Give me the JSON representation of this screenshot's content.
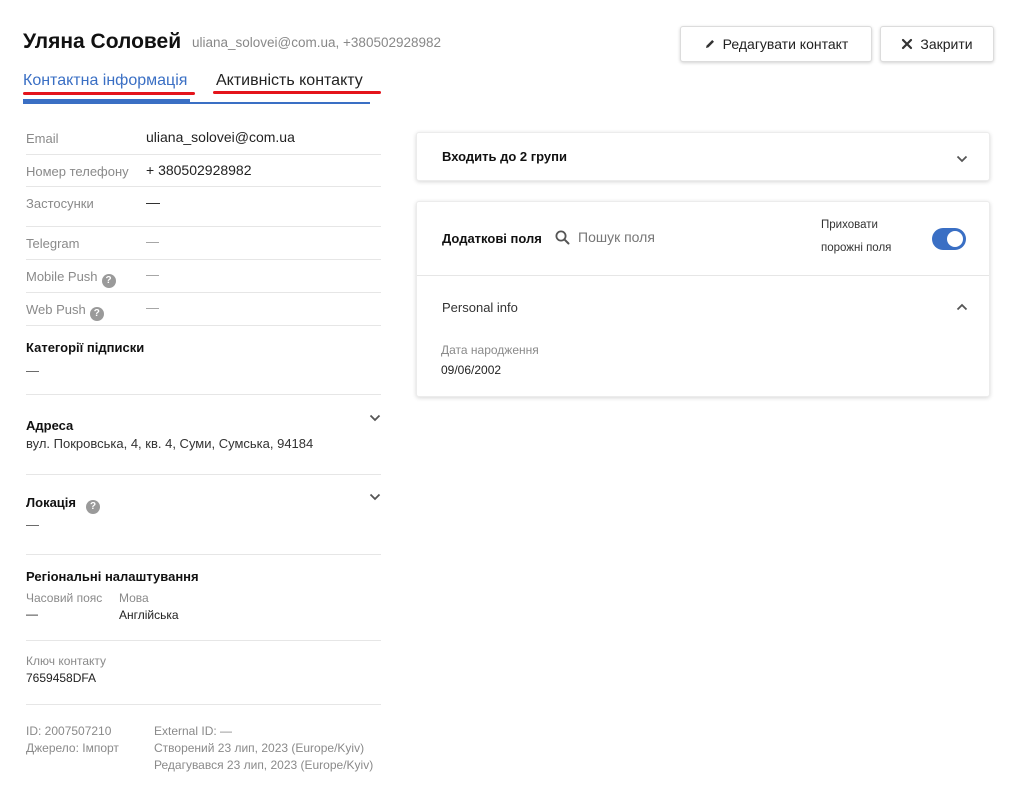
{
  "header": {
    "name": "Уляна Соловей",
    "subtitle": "uliana_solovei@com.ua, +380502928982",
    "edit_label": "Редагувати контакт",
    "close_label": "Закрити"
  },
  "tabs": [
    {
      "label": "Контактна інформація",
      "active": true
    },
    {
      "label": "Активність контакту",
      "active": false
    }
  ],
  "contact_rows": [
    {
      "label": "Email",
      "value": "uliana_solovei@com.ua"
    },
    {
      "label": "Номер телефону",
      "value": "+ 380502928982"
    },
    {
      "label": "Застосунки",
      "value": "—"
    },
    {
      "label": "Telegram",
      "value": "—"
    },
    {
      "label": "Mobile Push",
      "value": "—"
    },
    {
      "label": "Web Push",
      "value": "—"
    }
  ],
  "subscription": {
    "title": "Категорії підписки",
    "value": "—"
  },
  "address": {
    "title": "Адреса",
    "value": "вул. Покровська, 4, кв. 4, Суми, Сумська, 94184"
  },
  "location": {
    "title": "Локація",
    "value": "—"
  },
  "regional": {
    "title": "Регіональні налаштування",
    "timezone_label": "Часовий пояс",
    "timezone_value": "—",
    "language_label": "Мова",
    "language_value": "Англійська"
  },
  "contact_key": {
    "label": "Ключ контакту",
    "value": "7659458DFA"
  },
  "meta": {
    "id": "ID: 2007507210",
    "source": "Джерело:  Імпорт",
    "external_id": "External ID: —",
    "created": "Створений 23 лип, 2023 (Europe/Kyiv)",
    "edited": "Редагувався 23 лип, 2023 (Europe/Kyiv)"
  },
  "groups_card": {
    "title": "Входить до  2  групи"
  },
  "fields_card": {
    "title": "Додаткові поля",
    "search_placeholder": "Пошук поля",
    "hide_empty_line1": "Приховати",
    "hide_empty_line2": "порожні поля",
    "hide_empty_on": true,
    "section_title": "Personal info",
    "field_label": "Дата народження",
    "field_value": "09/06/2002"
  },
  "colors": {
    "accent": "#3a6fc4",
    "annotation_red": "#e4141b"
  },
  "icons": [
    "pencil-icon",
    "close-icon",
    "help-icon",
    "chevron-down-icon",
    "chevron-up-icon",
    "search-icon"
  ]
}
